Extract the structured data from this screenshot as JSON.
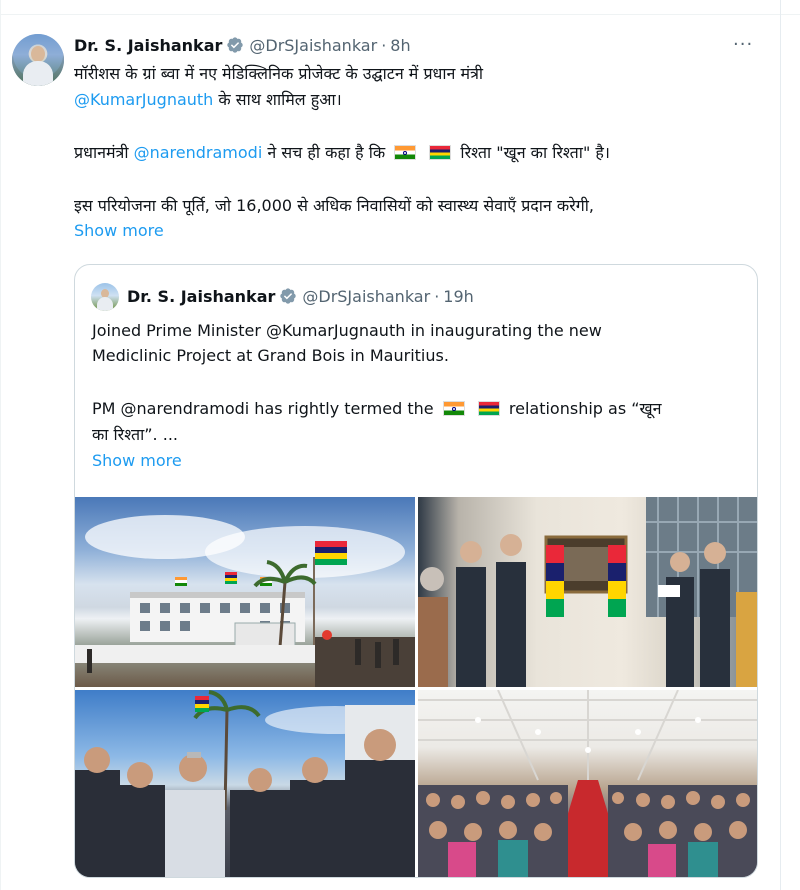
{
  "tweet": {
    "author_name": "Dr. S. Jaishankar",
    "handle": "@DrSJaishankar",
    "separator": "·",
    "time": "8h",
    "more_icon": "···",
    "line1": "मॉरीशस के ग्रां ब्वा में नए मेडिक्लिनिक प्रोजेक्ट के उद्घाटन में प्रधान मंत्री",
    "line2_mention": "@KumarJugnauth",
    "line2_rest": " के साथ शामिल हुआ।",
    "line3_pre": "प्रधानमंत्री ",
    "line3_mention": "@narendramodi",
    "line3_mid": " ने सच ही कहा है कि",
    "line3_post": " रिश्ता \"खून का रिश्ता\" है।",
    "line4": "इस परियोजना की पूर्ति, जो 16,000 से अधिक निवासियों को स्वास्थ्य सेवाएँ प्रदान करेगी,",
    "show_more": "Show more"
  },
  "quote": {
    "author_name": "Dr. S. Jaishankar",
    "handle": "@DrSJaishankar",
    "separator": "·",
    "time": "19h",
    "line1": "Joined Prime Minister @KumarJugnauth in inaugurating the new",
    "line2": "Mediclinic Project at Grand Bois in Mauritius.",
    "line3_pre": "PM @narendramodi has rightly termed the",
    "line3_post": " relationship as “खून",
    "line4": "का रिश्ता”. ...",
    "show_more": "Show more"
  },
  "colors": {
    "link": "#1d9bf0",
    "muted": "#536471",
    "text": "#0f1419",
    "border": "#cfd9de"
  },
  "icons": {
    "verified": "verified-badge-icon",
    "more": "more-options-icon"
  }
}
